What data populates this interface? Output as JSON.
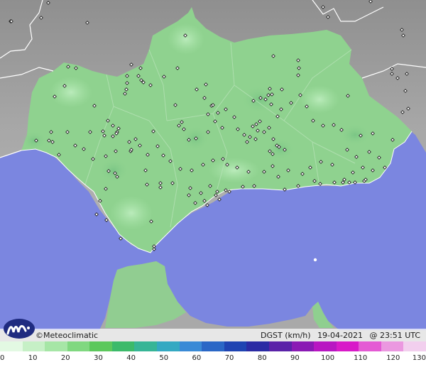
{
  "branding": {
    "name": "©Meteoclimatic",
    "logo_icon": "meteoclimatic-logo-icon"
  },
  "caption": {
    "variable": "DGST (km/h)",
    "date": "19-04-2021",
    "time": "@ 23:51 UTC"
  },
  "legend": {
    "ticks": [
      "0",
      "10",
      "20",
      "30",
      "40",
      "50",
      "60",
      "70",
      "80",
      "90",
      "100",
      "110",
      "120",
      "130"
    ],
    "max_value": 130,
    "colors": [
      "#e3f9e3",
      "#c6f0c6",
      "#a6e6a6",
      "#80d880",
      "#5cc85c",
      "#3cba6a",
      "#37b596",
      "#34a9c2",
      "#3a8ad6",
      "#2a67c6",
      "#1f44b2",
      "#2b2ba4",
      "#5a22a8",
      "#8a1ab4",
      "#b816c2",
      "#d81ac8",
      "#e45ad4",
      "#eb98e0",
      "#f2cfee"
    ]
  },
  "map": {
    "sea_color": "#7b86e0",
    "land_color": "#8fd28f",
    "outside_color": "#a3a3a3",
    "station_count": 190
  }
}
